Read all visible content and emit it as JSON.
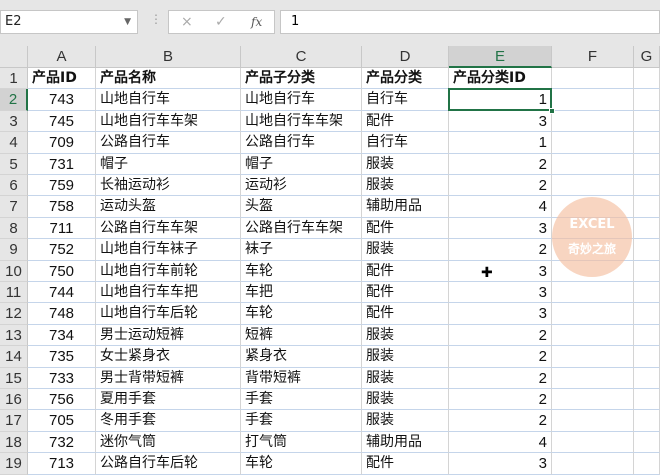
{
  "name_box": "E2",
  "formula_value": "1",
  "icons": {
    "cancel": "×",
    "enter": "✓",
    "fx": "fx"
  },
  "columns": [
    "A",
    "B",
    "C",
    "D",
    "E",
    "F",
    "G"
  ],
  "headers": [
    "产品ID",
    "产品名称",
    "产品子分类",
    "产品分类",
    "产品分类ID"
  ],
  "rows": [
    [
      "743",
      "山地自行车",
      "山地自行车",
      "自行车",
      "1"
    ],
    [
      "745",
      "山地自行车车架",
      "山地自行车车架",
      "配件",
      "3"
    ],
    [
      "709",
      "公路自行车",
      "公路自行车",
      "自行车",
      "1"
    ],
    [
      "731",
      "帽子",
      "帽子",
      "服装",
      "2"
    ],
    [
      "759",
      "长袖运动衫",
      "运动衫",
      "服装",
      "2"
    ],
    [
      "758",
      "运动头盔",
      "头盔",
      "辅助用品",
      "4"
    ],
    [
      "711",
      "公路自行车车架",
      "公路自行车车架",
      "配件",
      "3"
    ],
    [
      "752",
      "山地自行车袜子",
      "袜子",
      "服装",
      "2"
    ],
    [
      "750",
      "山地自行车前轮",
      "车轮",
      "配件",
      "3"
    ],
    [
      "744",
      "山地自行车车把",
      "车把",
      "配件",
      "3"
    ],
    [
      "748",
      "山地自行车后轮",
      "车轮",
      "配件",
      "3"
    ],
    [
      "734",
      "男士运动短裤",
      "短裤",
      "服装",
      "2"
    ],
    [
      "735",
      "女士紧身衣",
      "紧身衣",
      "服装",
      "2"
    ],
    [
      "733",
      "男士背带短裤",
      "背带短裤",
      "服装",
      "2"
    ],
    [
      "756",
      "夏用手套",
      "手套",
      "服装",
      "2"
    ],
    [
      "705",
      "冬用手套",
      "手套",
      "服装",
      "2"
    ],
    [
      "732",
      "迷你气筒",
      "打气筒",
      "辅助用品",
      "4"
    ],
    [
      "713",
      "公路自行车后轮",
      "车轮",
      "配件",
      "3"
    ]
  ],
  "watermark": {
    "line1": "EXCEL",
    "line2": "奇妙之旅"
  }
}
